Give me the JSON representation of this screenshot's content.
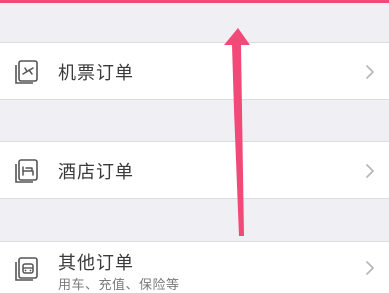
{
  "orders": {
    "flight": {
      "title": "机票订单",
      "icon": "flight-ticket-icon"
    },
    "hotel": {
      "title": "酒店订单",
      "icon": "hotel-bed-icon"
    },
    "other": {
      "title": "其他订单",
      "subtitle": "用车、充值、保险等",
      "icon": "car-icon"
    }
  },
  "colors": {
    "accent": "#f24a78",
    "icon_stroke": "#555555",
    "chevron": "#b8b8bc",
    "background": "#efeff4",
    "card": "#ffffff"
  },
  "annotation": {
    "type": "arrow",
    "direction": "up"
  }
}
